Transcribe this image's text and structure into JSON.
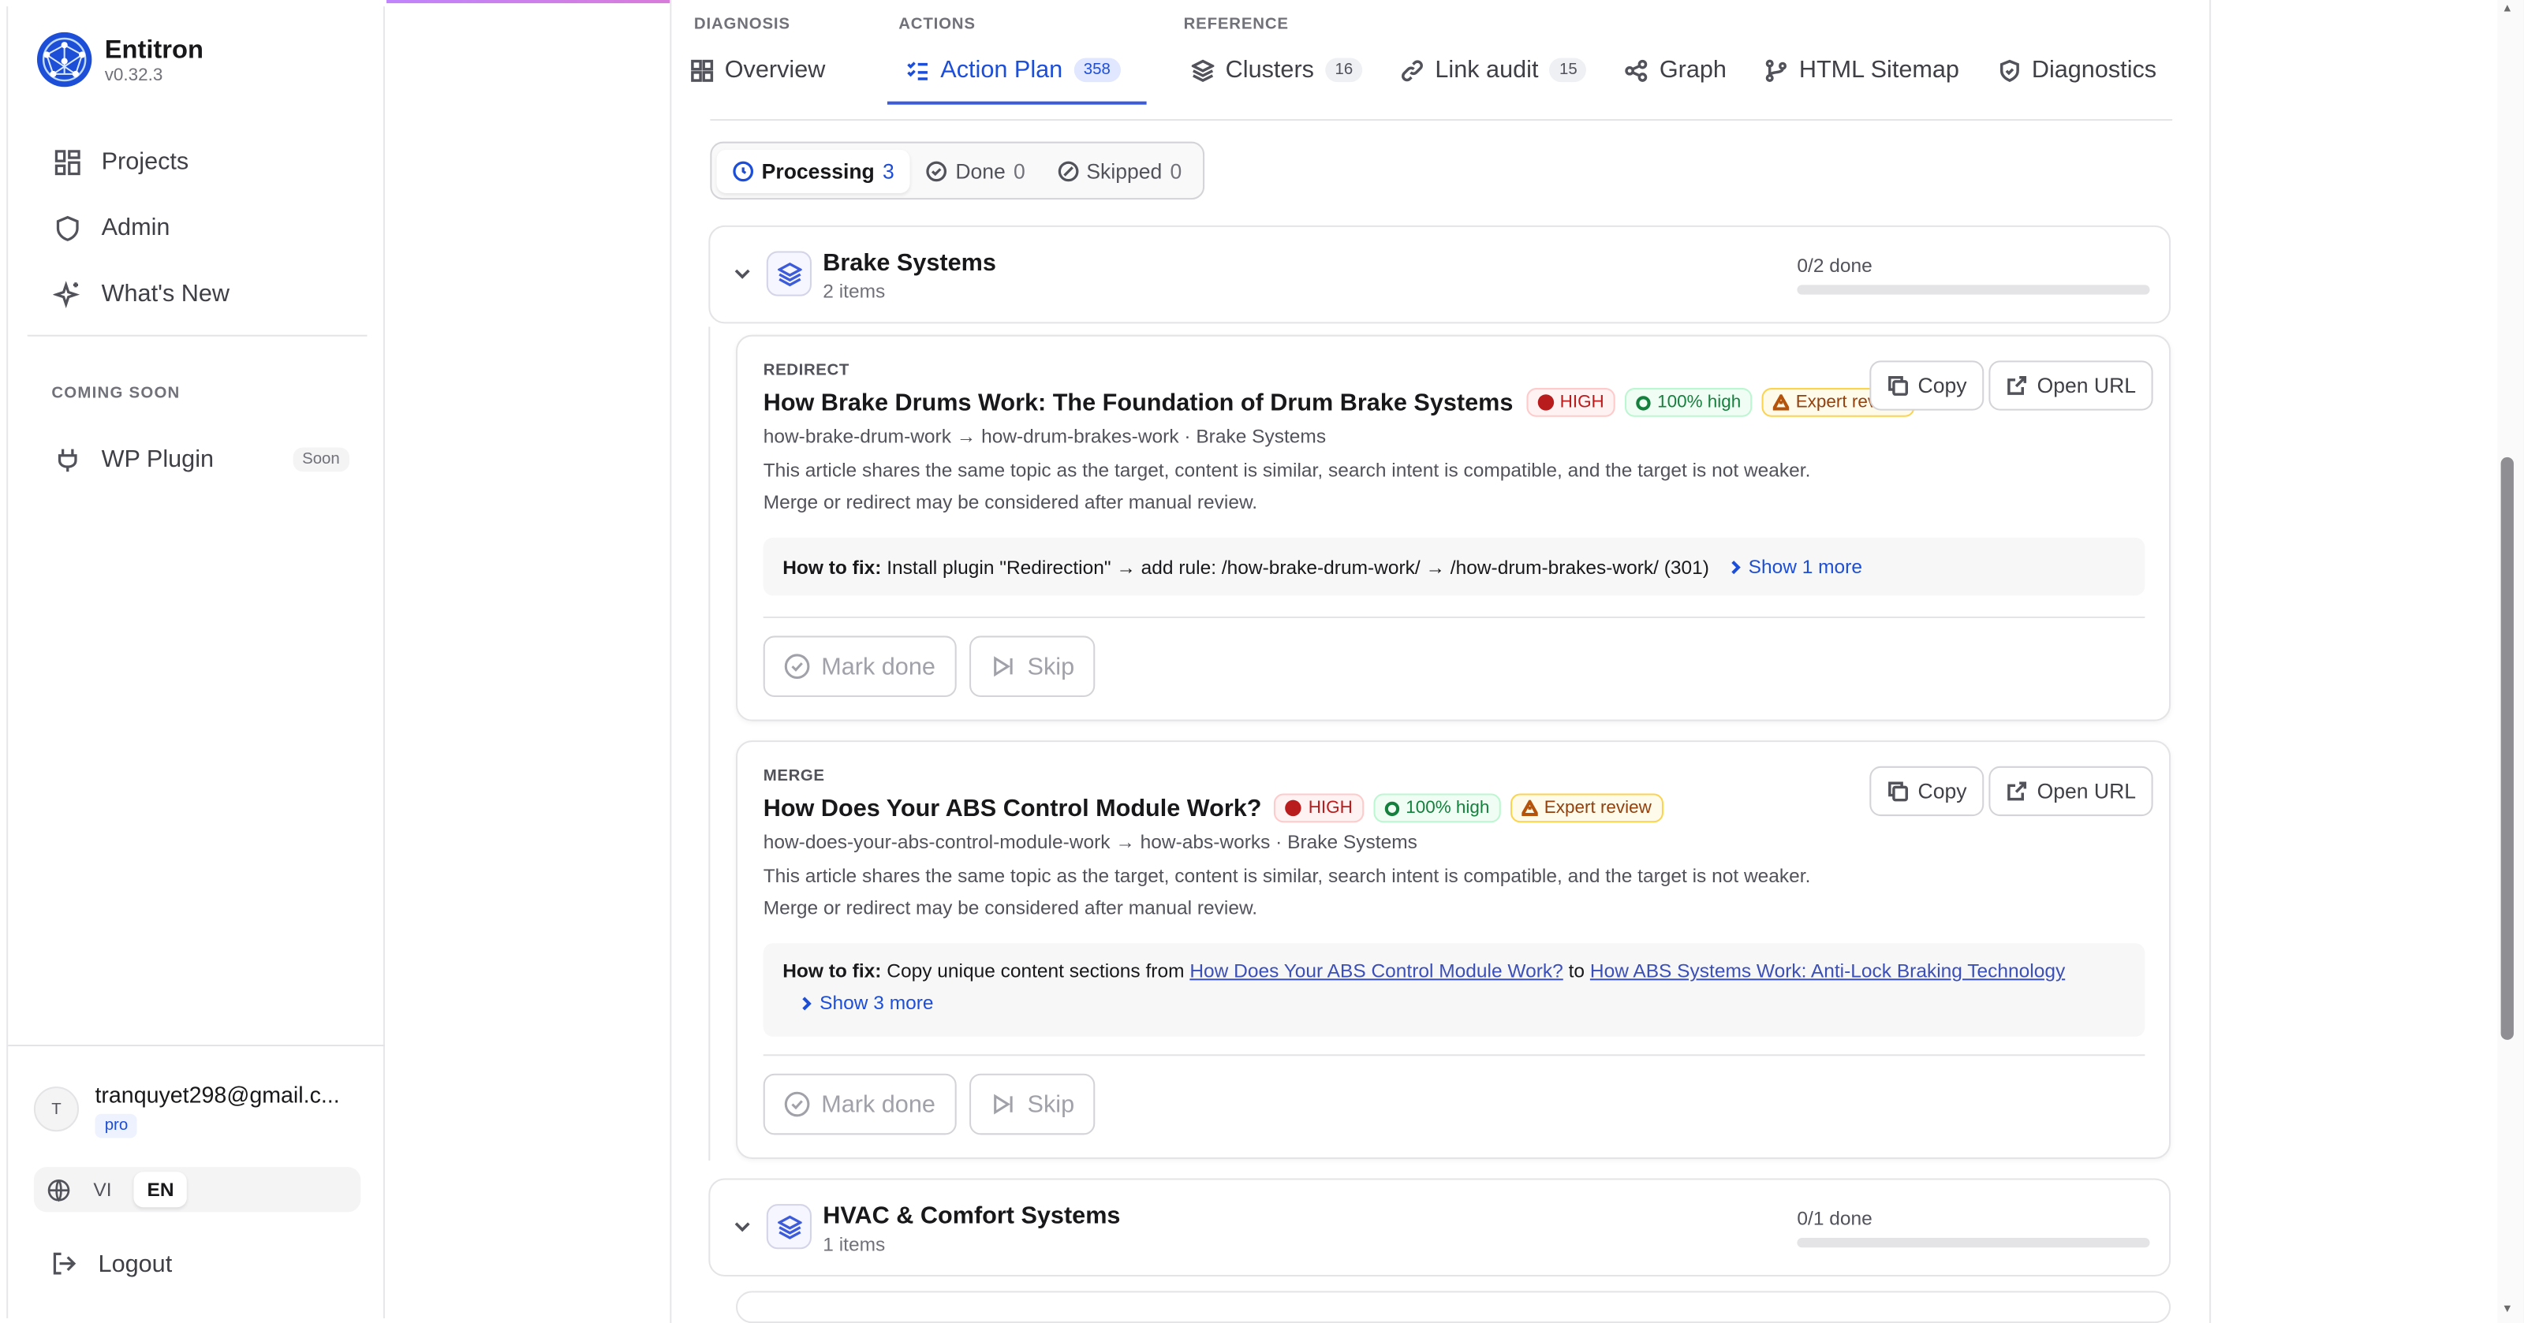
{
  "app": {
    "name": "Entitron",
    "version": "v0.32.3"
  },
  "sidebar": {
    "items": [
      {
        "label": "Projects",
        "icon": "grid-icon"
      },
      {
        "label": "Admin",
        "icon": "shield-icon"
      },
      {
        "label": "What's New",
        "icon": "sparkles-icon"
      }
    ],
    "coming_soon_label": "COMING SOON",
    "wp_plugin": {
      "label": "WP Plugin",
      "badge": "Soon",
      "icon": "plug-icon"
    },
    "user": {
      "avatar_initial": "T",
      "email": "tranquyet298@gmail.c...",
      "plan": "pro"
    },
    "languages": {
      "options": [
        "VI",
        "EN"
      ],
      "selected": "EN"
    },
    "logout_label": "Logout"
  },
  "tab_groups": {
    "diagnosis": "DIAGNOSIS",
    "actions": "ACTIONS",
    "reference": "REFERENCE"
  },
  "tabs": [
    {
      "label": "Overview",
      "count": null,
      "icon": "grid-icon",
      "active": false
    },
    {
      "label": "Action Plan",
      "count": "358",
      "icon": "checklist-icon",
      "active": true
    },
    {
      "label": "Clusters",
      "count": "16",
      "icon": "layers-icon",
      "active": false
    },
    {
      "label": "Link audit",
      "count": "15",
      "icon": "link-icon",
      "active": false
    },
    {
      "label": "Graph",
      "count": null,
      "icon": "share-icon",
      "active": false
    },
    {
      "label": "HTML Sitemap",
      "count": null,
      "icon": "git-branch-icon",
      "active": false
    },
    {
      "label": "Diagnostics",
      "count": null,
      "icon": "shield-check-icon",
      "active": false
    }
  ],
  "filters": [
    {
      "label": "Processing",
      "count": "3",
      "selected": true
    },
    {
      "label": "Done",
      "count": "0",
      "selected": false
    },
    {
      "label": "Skipped",
      "count": "0",
      "selected": false
    }
  ],
  "clusters": [
    {
      "title": "Brake Systems",
      "items_text": "2 items",
      "done_text": "0/2 done",
      "progress": 0
    },
    {
      "title": "HVAC & Comfort Systems",
      "items_text": "1 items",
      "done_text": "0/1 done",
      "progress": 0
    }
  ],
  "actions": [
    {
      "type": "REDIRECT",
      "title": "How Brake Drums Work: The Foundation of Drum Brake Systems",
      "priority": "HIGH",
      "confidence": "100% high",
      "review": "Expert review",
      "slug_line": "how-brake-drum-work → how-drum-brakes-work · Brake Systems",
      "description": "This article shares the same topic as the target, content is similar, search intent is compatible, and the target is not weaker. Merge or redirect may be considered after manual review.",
      "fix_label": "How to fix:",
      "fix_text": "Install plugin \"Redirection\" → add rule: /how-brake-drum-work/ → /how-drum-brakes-work/ (301)",
      "show_more": "Show 1 more",
      "copy_label": "Copy",
      "open_label": "Open URL",
      "mark_done_label": "Mark done",
      "skip_label": "Skip"
    },
    {
      "type": "MERGE",
      "title": "How Does Your ABS Control Module Work?",
      "priority": "HIGH",
      "confidence": "100% high",
      "review": "Expert review",
      "slug_line": "how-does-your-abs-control-module-work → how-abs-works · Brake Systems",
      "description": "This article shares the same topic as the target, content is similar, search intent is compatible, and the target is not weaker. Merge or redirect may be considered after manual review.",
      "fix_label": "How to fix:",
      "fix_text_pre": "Copy unique content sections from",
      "fix_link1": "How Does Your ABS Control Module Work?",
      "fix_mid": "to",
      "fix_link2": "How ABS Systems Work: Anti-Lock Braking Technology",
      "show_more": "Show 3 more",
      "copy_label": "Copy",
      "open_label": "Open URL",
      "mark_done_label": "Mark done",
      "skip_label": "Skip"
    }
  ]
}
